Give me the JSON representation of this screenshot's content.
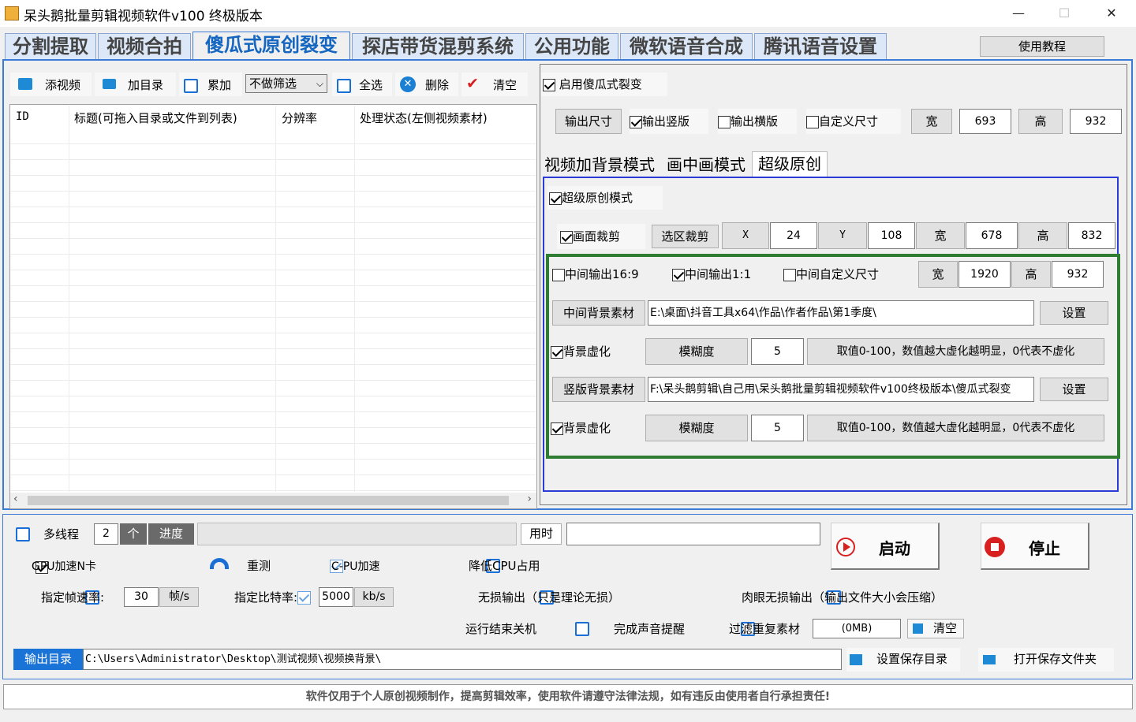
{
  "window": {
    "title": "呆头鹅批量剪辑视频软件v100 终极版本",
    "minimize": "—",
    "maximize": "☐",
    "close": "✕"
  },
  "main_tabs": [
    "分割提取",
    "视频合拍",
    "傻瓜式原创裂变",
    "探店带货混剪系统",
    "公用功能",
    "微软语音合成",
    "腾讯语音设置"
  ],
  "tutorial_button": "使用教程",
  "toolbar": {
    "add_video": "添视频",
    "add_dir": "加目录",
    "accumulate": "累加",
    "filter_value": "不做筛选",
    "select_all": "全选",
    "delete": "删除",
    "clear": "清空"
  },
  "table": {
    "columns": [
      "ID",
      "标题(可拖入目录或文件到列表)",
      "分辨率",
      "处理状态(左侧视频素材)"
    ]
  },
  "right": {
    "enable_fission": "启用傻瓜式裂变",
    "output_size_btn": "输出尺寸",
    "output_portrait": "输出竖版",
    "output_landscape": "输出横版",
    "custom_size": "自定义尺寸",
    "width_label": "宽",
    "width_value": "693",
    "height_label": "高",
    "height_value": "932",
    "sub_tabs": [
      "视频加背景模式",
      "画中画模式",
      "超级原创"
    ],
    "super_mode": "超级原创模式",
    "crop": {
      "label": "画面裁剪",
      "button": "选区裁剪",
      "x_label": "X",
      "x_value": "24",
      "y_label": "Y",
      "y_value": "108",
      "w_label": "宽",
      "w_value": "678",
      "h_label": "高",
      "h_value": "832"
    },
    "mid16_9": "中间输出16:9",
    "mid1_1": "中间输出1:1",
    "mid_custom": "中间自定义尺寸",
    "mid_w_label": "宽",
    "mid_w_value": "1920",
    "mid_h_label": "高",
    "mid_h_value": "932",
    "mid_bg_label": "中间背景素材",
    "mid_bg_path": "E:\\桌面\\抖音工具x64\\作品\\作者作品\\第1季度\\",
    "set1": "设置",
    "blur1": {
      "label": "背景虚化",
      "btn": "模糊度",
      "value": "5",
      "hint": "取值0-100，数值越大虚化越明显，0代表不虚化"
    },
    "vert_bg_label": "竖版背景素材",
    "vert_bg_path": "F:\\呆头鹅剪辑\\自己用\\呆头鹅批量剪辑视频软件v100终极版本\\傻瓜式裂变",
    "set2": "设置",
    "blur2": {
      "label": "背景虚化",
      "btn": "模糊度",
      "value": "5",
      "hint": "取值0-100，数值越大虚化越明显，0代表不虚化"
    }
  },
  "bottom": {
    "multithread": "多线程",
    "threads": "2",
    "threads_unit": "个",
    "progress_label": "进度",
    "elapsed_label": "用时",
    "start": "启动",
    "stop": "停止",
    "gpu": "GPU加速N卡",
    "retest": "重测",
    "cpu_accel": "C-PU加速",
    "lower_cpu": "降低CPU占用",
    "fps_label": "指定帧速率:",
    "fps_value": "30",
    "fps_unit": "帧/s",
    "bitrate_label": "指定比特率:",
    "bitrate_value": "5000",
    "bitrate_unit": "kb/s",
    "lossless": "无损输出（只是理论无损）",
    "visual_lossless": "肉眼无损输出（输出文件大小会压缩）",
    "shutdown": "运行结束关机",
    "sound": "完成声音提醒",
    "filter_dup": "过滤重复素材",
    "size_value": "(0MB)",
    "clear": "清空",
    "output_dir_label": "输出目录",
    "output_dir": "C:\\Users\\Administrator\\Desktop\\测试视频\\视频换背景\\",
    "set_save_dir": "设置保存目录",
    "open_save_dir": "打开保存文件夹"
  },
  "footer": "软件仅用于个人原创视频制作，提高剪辑效率，使用软件请遵守法律法规，如有违反由使用者自行承担责任!",
  "colors": {
    "accent": "#1566c0",
    "green_frame": "#2e7d32",
    "blue_frame": "#2a3bd6",
    "start_red": "#d82020"
  }
}
